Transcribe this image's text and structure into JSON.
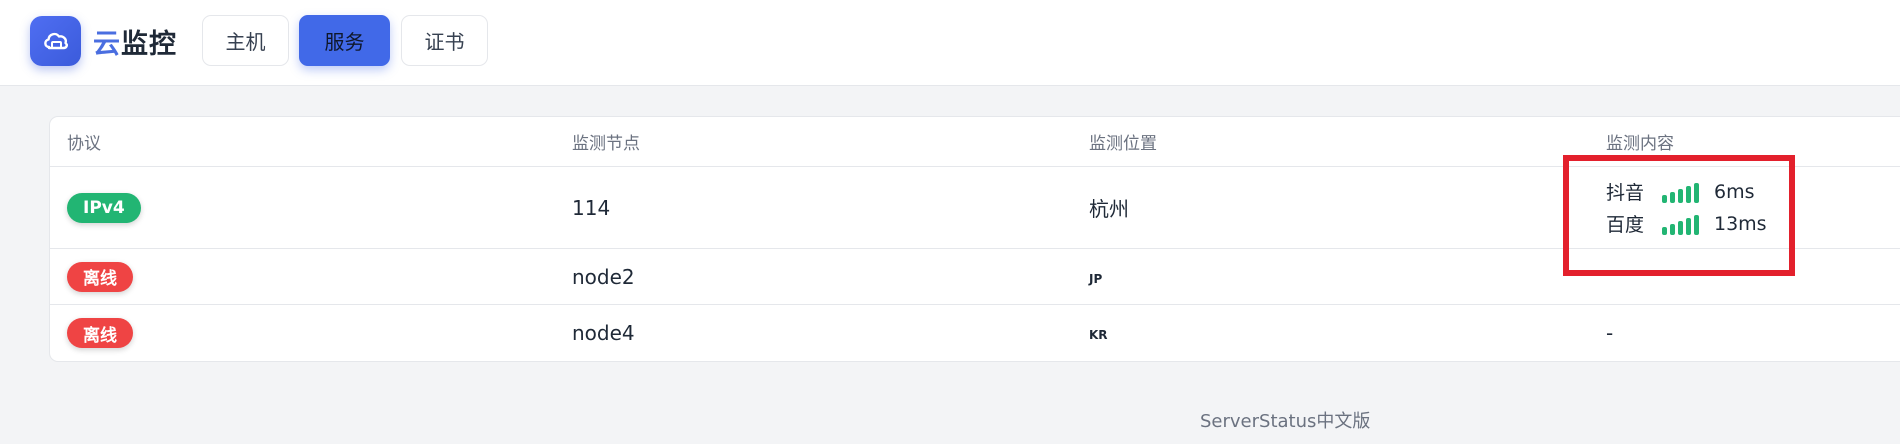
{
  "header": {
    "brand_accent": "云",
    "brand_rest": "监控",
    "logo_icon": "cloud-icon",
    "nav": [
      {
        "label": "主机",
        "active": false
      },
      {
        "label": "服务",
        "active": true
      },
      {
        "label": "证书",
        "active": false
      }
    ]
  },
  "table": {
    "columns": [
      "协议",
      "监测节点",
      "监测位置",
      "监测内容"
    ],
    "rows": [
      {
        "protocol": "IPv4",
        "status": "online",
        "node": "114",
        "location": "杭州",
        "monitors": [
          {
            "name": "抖音",
            "latency": "6ms",
            "signal_level": 5
          },
          {
            "name": "百度",
            "latency": "13ms",
            "signal_level": 5
          }
        ]
      },
      {
        "protocol": "离线",
        "status": "offline",
        "node": "node2",
        "location": "JP",
        "content": ""
      },
      {
        "protocol": "离线",
        "status": "offline",
        "node": "node4",
        "location": "KR",
        "content": "-"
      }
    ]
  },
  "footer": {
    "text": "ServerStatus中文版"
  },
  "colors": {
    "primary": "#4169e8",
    "success": "#22b573",
    "danger": "#ef4444",
    "highlight": "#e3202c"
  }
}
